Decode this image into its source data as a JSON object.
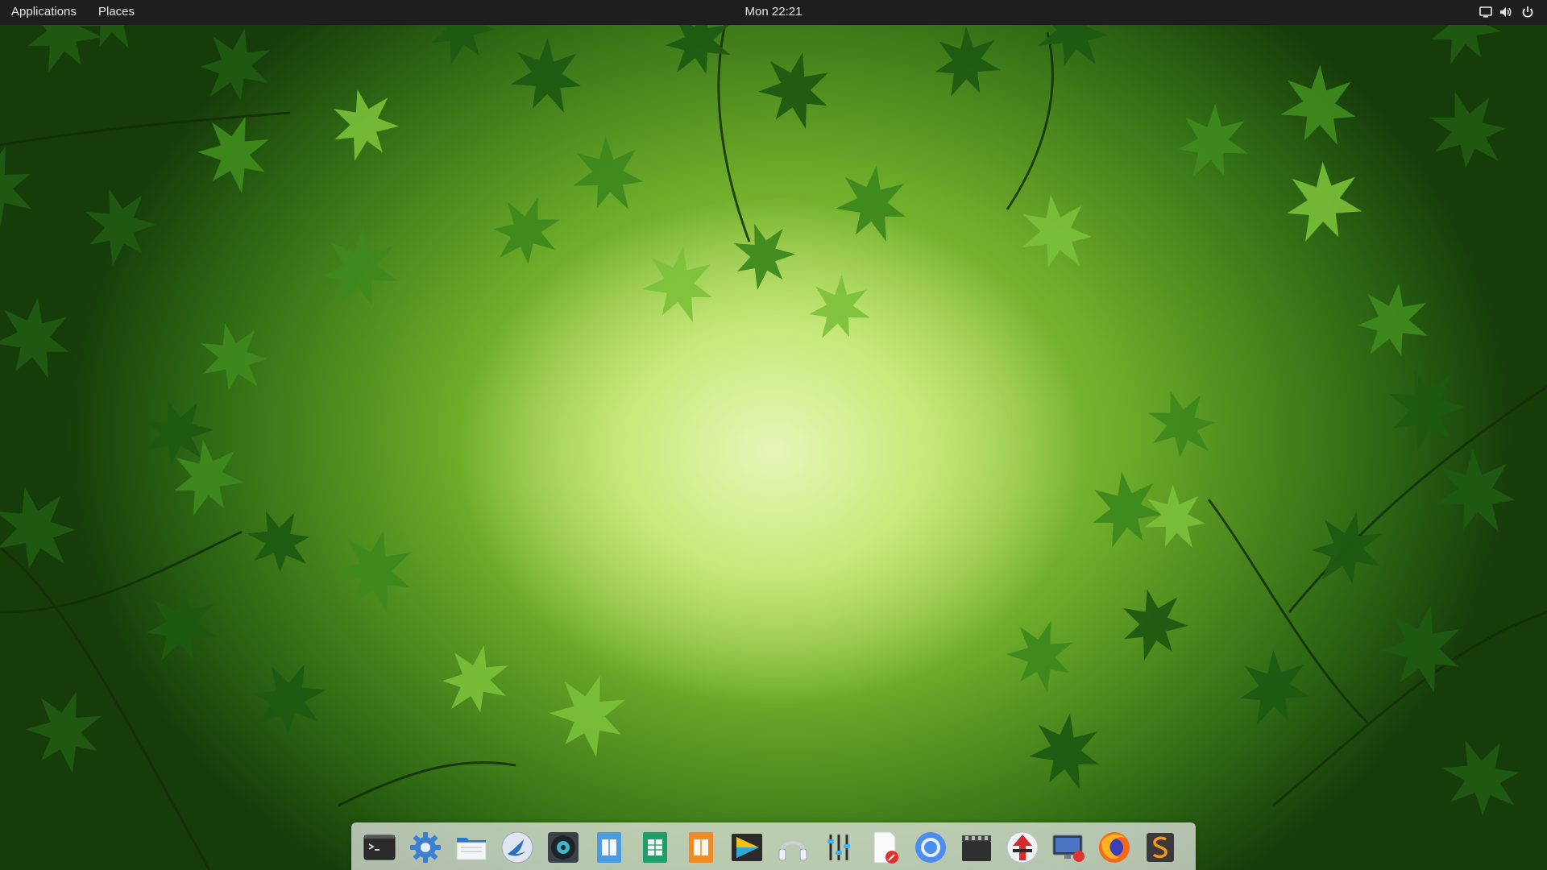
{
  "topbar": {
    "applications_label": "Applications",
    "places_label": "Places",
    "clock": "Mon 22:21",
    "tray": [
      {
        "name": "display-icon"
      },
      {
        "name": "volume-icon"
      },
      {
        "name": "power-icon"
      }
    ]
  },
  "dock": {
    "items": [
      {
        "name": "terminal-icon"
      },
      {
        "name": "settings-gear-icon"
      },
      {
        "name": "files-icon"
      },
      {
        "name": "bird-app-icon"
      },
      {
        "name": "music-disc-icon"
      },
      {
        "name": "document-reader-icon"
      },
      {
        "name": "spreadsheet-icon"
      },
      {
        "name": "presentation-icon"
      },
      {
        "name": "media-player-icon"
      },
      {
        "name": "headphones-icon"
      },
      {
        "name": "equalizer-icon"
      },
      {
        "name": "text-editor-icon"
      },
      {
        "name": "chrome-icon"
      },
      {
        "name": "video-clapper-icon"
      },
      {
        "name": "download-manager-icon"
      },
      {
        "name": "screen-recorder-icon"
      },
      {
        "name": "firefox-icon"
      },
      {
        "name": "sublime-text-icon"
      }
    ]
  },
  "colors": {
    "topbar_bg": "#1e1e1e",
    "leaf_dark": "#1f5a12",
    "leaf_mid": "#3f8a1e",
    "leaf_light": "#7cc13a",
    "center_glow": "#e6f6b8"
  }
}
